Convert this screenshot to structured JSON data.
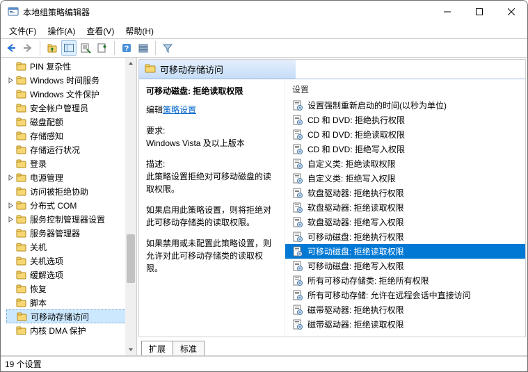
{
  "window": {
    "title": "本地组策略编辑器"
  },
  "menu": {
    "file": "文件(F)",
    "action": "操作(A)",
    "view": "查看(V)",
    "help": "帮助(H)"
  },
  "tree": {
    "items": [
      {
        "label": "PIN 复杂性",
        "expandable": false,
        "selected": false,
        "sub": false
      },
      {
        "label": "Windows 时间服务",
        "expandable": true,
        "selected": false,
        "sub": false
      },
      {
        "label": "Windows 文件保护",
        "expandable": false,
        "selected": false,
        "sub": false
      },
      {
        "label": "安全帐户管理员",
        "expandable": false,
        "selected": false,
        "sub": false
      },
      {
        "label": "磁盘配额",
        "expandable": false,
        "selected": false,
        "sub": false
      },
      {
        "label": "存储感知",
        "expandable": false,
        "selected": false,
        "sub": false
      },
      {
        "label": "存储运行状况",
        "expandable": false,
        "selected": false,
        "sub": false
      },
      {
        "label": "登录",
        "expandable": false,
        "selected": false,
        "sub": false
      },
      {
        "label": "电源管理",
        "expandable": true,
        "selected": false,
        "sub": false
      },
      {
        "label": "访问被拒绝协助",
        "expandable": false,
        "selected": false,
        "sub": false
      },
      {
        "label": "分布式 COM",
        "expandable": true,
        "selected": false,
        "sub": false
      },
      {
        "label": "服务控制管理器设置",
        "expandable": true,
        "selected": false,
        "sub": false
      },
      {
        "label": "服务器管理器",
        "expandable": false,
        "selected": false,
        "sub": false
      },
      {
        "label": "关机",
        "expandable": false,
        "selected": false,
        "sub": false
      },
      {
        "label": "关机选项",
        "expandable": false,
        "selected": false,
        "sub": false
      },
      {
        "label": "缓解选项",
        "expandable": false,
        "selected": false,
        "sub": false
      },
      {
        "label": "恢复",
        "expandable": false,
        "selected": false,
        "sub": false
      },
      {
        "label": "脚本",
        "expandable": false,
        "selected": false,
        "sub": false
      },
      {
        "label": "可移动存储访问",
        "expandable": false,
        "selected": true,
        "sub": false
      },
      {
        "label": "内核 DMA 保护",
        "expandable": false,
        "selected": false,
        "sub": false
      }
    ]
  },
  "panel": {
    "header": "可移动存储访问",
    "selected_title": "可移动磁盘: 拒绝读取权限",
    "edit_label_prefix": "编辑",
    "edit_link": "策略设置",
    "req_label": "要求:",
    "req_value": "Windows Vista 及以上版本",
    "desc_label": "描述:",
    "desc_para1": "此策略设置拒绝对可移动磁盘的读取权限。",
    "desc_para2": "如果启用此策略设置，则将拒绝对此可移动存储类的读取权限。",
    "desc_para3": "如果禁用或未配置此策略设置，则允许对此可移动存储类的读取权限。",
    "settings_header": "设置",
    "settings": [
      "设置强制重新启动的时间(以秒为单位)",
      "CD 和 DVD: 拒绝执行权限",
      "CD 和 DVD: 拒绝读取权限",
      "CD 和 DVD: 拒绝写入权限",
      "自定义类: 拒绝读取权限",
      "自定义类: 拒绝写入权限",
      "软盘驱动器: 拒绝执行权限",
      "软盘驱动器: 拒绝读取权限",
      "软盘驱动器: 拒绝写入权限",
      "可移动磁盘: 拒绝执行权限",
      "可移动磁盘: 拒绝读取权限",
      "可移动磁盘: 拒绝写入权限",
      "所有可移动存储类: 拒绝所有权限",
      "所有可移动存储: 允许在远程会话中直接访问",
      "磁带驱动器: 拒绝执行权限",
      "磁带驱动器: 拒绝读取权限"
    ],
    "selected_setting_index": 10
  },
  "tabs": {
    "extended": "扩展",
    "standard": "标准"
  },
  "status": {
    "count": "19 个设置"
  }
}
